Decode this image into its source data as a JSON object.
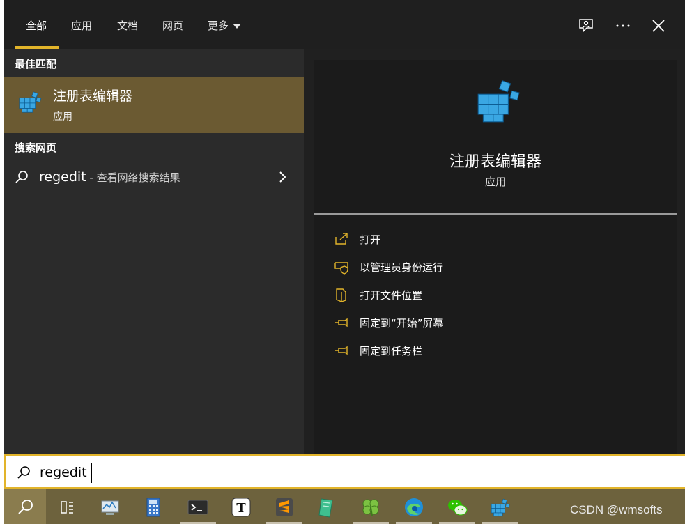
{
  "tabs": [
    {
      "label": "全部",
      "active": true
    },
    {
      "label": "应用"
    },
    {
      "label": "文档"
    },
    {
      "label": "网页"
    },
    {
      "label": "更多"
    }
  ],
  "top_icons": [
    "feedback-icon",
    "more-options-icon",
    "close-icon"
  ],
  "left": {
    "best_match_heading": "最佳匹配",
    "best_match": {
      "title": "注册表编辑器",
      "subtitle": "应用",
      "icon": "registry-editor-icon"
    },
    "web_heading": "搜索网页",
    "web_result": {
      "query": "regedit",
      "suffix": " - 查看网络搜索结果"
    }
  },
  "preview": {
    "title": "注册表编辑器",
    "subtitle": "应用",
    "actions": [
      {
        "label": "打开",
        "icon": "open-icon"
      },
      {
        "label": "以管理员身份运行",
        "icon": "shield-icon"
      },
      {
        "label": "打开文件位置",
        "icon": "file-location-icon"
      },
      {
        "label": "固定到“开始”屏幕",
        "icon": "pin-icon"
      },
      {
        "label": "固定到任务栏",
        "icon": "pin-icon"
      }
    ]
  },
  "search": {
    "value": "regedit"
  },
  "taskbar": {
    "items": [
      "search-icon",
      "task-view-icon",
      "performance-monitor-icon",
      "calculator-icon",
      "terminal-icon",
      "typora-icon",
      "sublime-text-icon",
      "notebook-icon",
      "clover-icon",
      "edge-icon",
      "wechat-icon",
      "registry-editor-icon"
    ]
  },
  "watermark": "CSDN @wmsofts",
  "colors": {
    "accent": "#e2b42a",
    "selected_bg": "#6b5a32",
    "taskbar": "#6d623d"
  }
}
